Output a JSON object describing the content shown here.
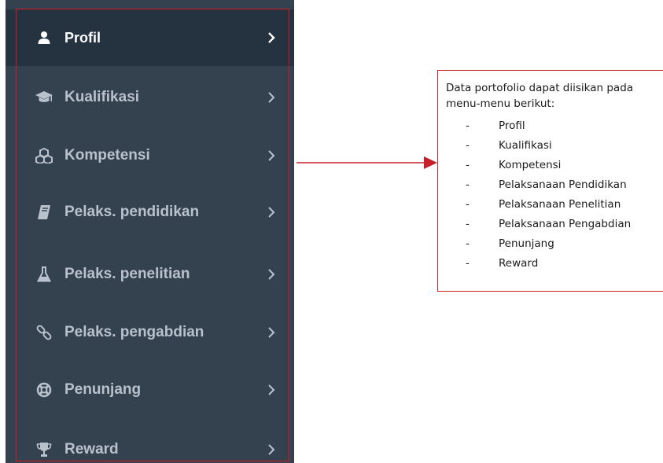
{
  "sidebar": {
    "items": [
      {
        "label": "Profil",
        "icon": "user-icon",
        "active": true
      },
      {
        "label": "Kualifikasi",
        "icon": "graduation-cap-icon",
        "active": false
      },
      {
        "label": "Kompetensi",
        "icon": "cubes-icon",
        "active": false
      },
      {
        "label": "Pelaks. pendidikan",
        "icon": "book-icon",
        "active": false
      },
      {
        "label": "Pelaks. penelitian",
        "icon": "flask-icon",
        "active": false
      },
      {
        "label": "Pelaks. pengabdian",
        "icon": "link-icon",
        "active": false
      },
      {
        "label": "Penunjang",
        "icon": "life-ring-icon",
        "active": false
      },
      {
        "label": "Reward",
        "icon": "trophy-icon",
        "active": false
      }
    ]
  },
  "callout": {
    "intro": "Data portofolio dapat diisikan pada menu-menu berikut:",
    "dash": "-",
    "items": [
      "Profil",
      "Kualifikasi",
      "Kompetensi",
      "Pelaksanaan Pendidikan",
      "Pelaksanaan Penelitian",
      "Pelaksanaan Pengabdian",
      "Penunjang",
      "Reward"
    ]
  },
  "colors": {
    "sidebar_bg": "#34414f",
    "active_bg": "#253240",
    "annotation_red": "#d6171e"
  }
}
